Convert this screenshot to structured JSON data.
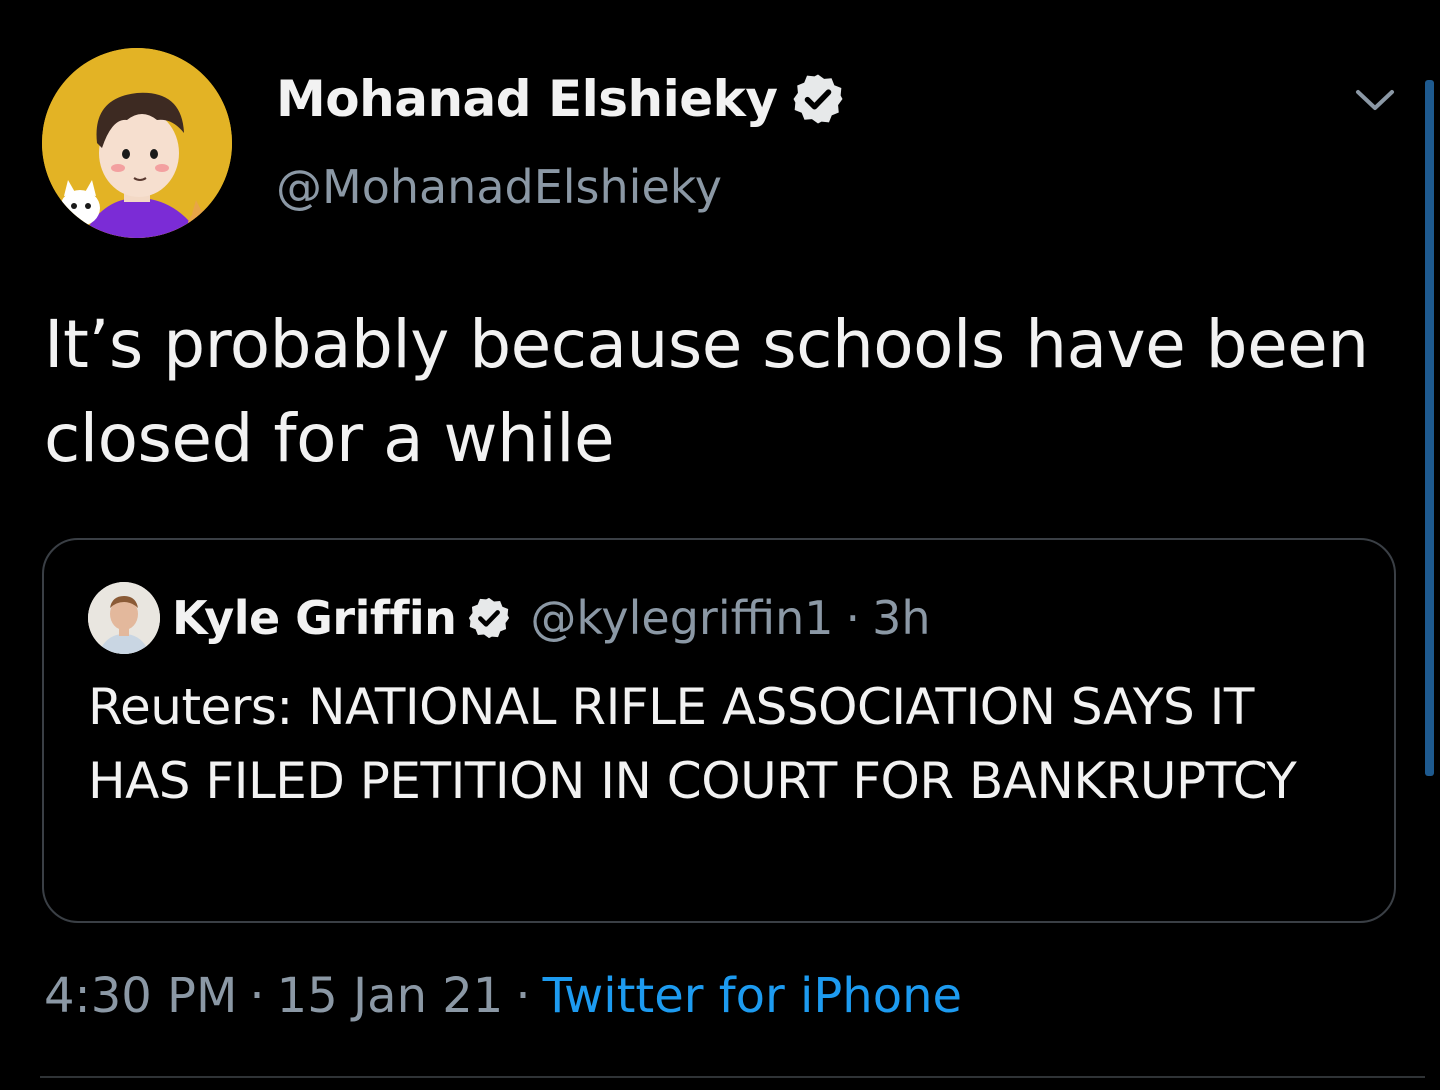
{
  "tweet": {
    "author": {
      "display_name": "Mohanad Elshieky",
      "handle": "@MohanadElshieky",
      "verified": true,
      "avatar_icon": "cartoon-avatar-with-cats"
    },
    "text": "It’s probably because schools have been closed for a while",
    "quoted": {
      "display_name": "Kyle Griffin",
      "handle": "@kylegriffin1",
      "separator": "·",
      "time": "3h",
      "verified": true,
      "text": "Reuters: NATIONAL RIFLE ASSOCIATION SAYS IT HAS FILED PETITION IN COURT FOR BANKRUPTCY"
    },
    "meta": {
      "time": "4:30 PM",
      "separator": "·",
      "date": "15 Jan 21",
      "separator2": "·",
      "source": "Twitter for iPhone"
    }
  },
  "colors": {
    "background": "#000000",
    "text": "#f2f2f2",
    "secondary": "#8b98a5",
    "accent": "#1d9bf0",
    "border": "#3a3f45"
  },
  "icons": {
    "menu": "chevron-down-icon",
    "verified": "verified-badge-icon"
  }
}
